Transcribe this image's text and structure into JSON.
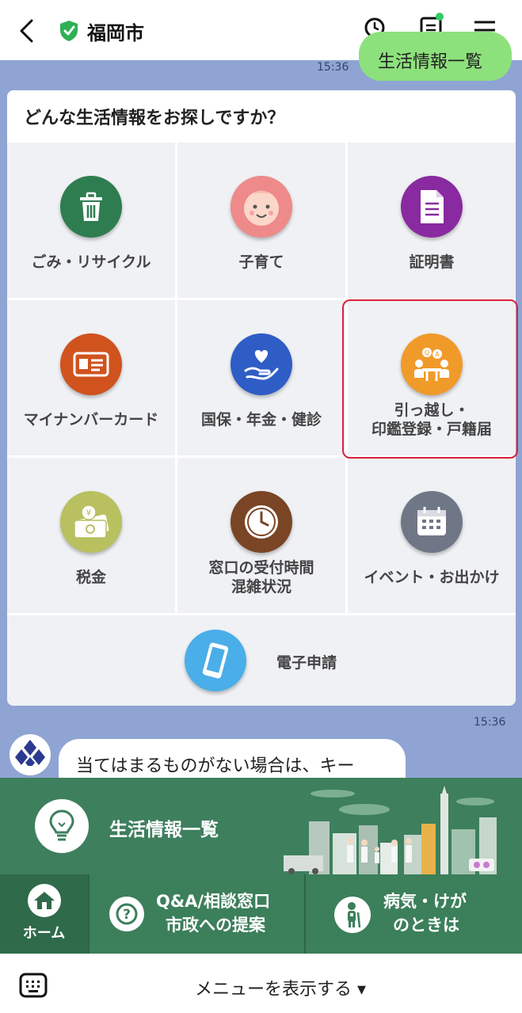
{
  "header": {
    "title": "福岡市",
    "colors": {
      "shield": "#2fb055",
      "notif": "#33cc66"
    }
  },
  "chat": {
    "outgoing": {
      "time": "15:36",
      "text": "生活情報一覧"
    },
    "card": {
      "title": "どんな生活情報をお探しですか？",
      "items": [
        {
          "label": "ごみ・リサイクル",
          "icon": "trash-icon",
          "color": "#2e7d50"
        },
        {
          "label": "子育て",
          "icon": "baby-icon",
          "color": "#ee8a8a"
        },
        {
          "label": "証明書",
          "icon": "document-icon",
          "color": "#8a2aa0"
        },
        {
          "label": "マイナンバーカード",
          "icon": "id-card-icon",
          "color": "#d0531e"
        },
        {
          "label": "国保・年金・健診",
          "icon": "heart-hand-icon",
          "color": "#2f5dc6"
        },
        {
          "label": "引っ越し・",
          "label2": "印鑑登録・戸籍届",
          "icon": "consult-icon",
          "color": "#f09a2a"
        },
        {
          "label": "税金",
          "icon": "money-icon",
          "color": "#b9c060"
        },
        {
          "label": "窓口の受付時間",
          "label2": "混雑状況",
          "icon": "clock-icon",
          "color": "#7a4524"
        },
        {
          "label": "イベント・お出かけ",
          "icon": "calendar-icon",
          "color": "#6f7787"
        },
        {
          "label": "電子申請",
          "icon": "tablet-icon",
          "color": "#4aaee8"
        }
      ]
    },
    "incoming": {
      "time": "15:36",
      "text": "当てはまるものがない場合は、キー"
    }
  },
  "rich_menu": {
    "main_label": "生活情報一覧",
    "home_label": "ホーム",
    "qa_line1": "Q&A/相談窓口",
    "qa_line2": "市政への提案",
    "sick_line1": "病気・けが",
    "sick_line2": "のときは"
  },
  "bottom_bar": {
    "menu_toggle": "メニューを表示する ▾"
  }
}
